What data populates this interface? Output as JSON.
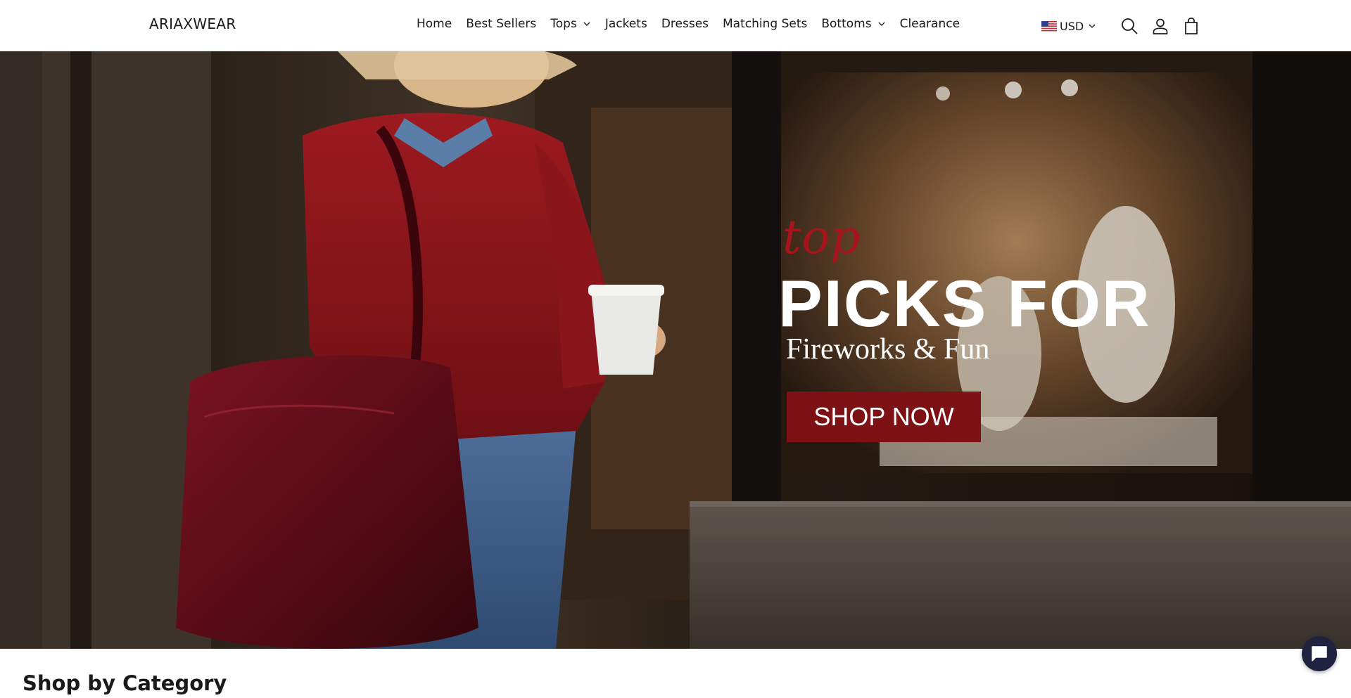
{
  "header": {
    "logo": "ARIAXWEAR",
    "nav": [
      {
        "label": "Home"
      },
      {
        "label": "Best Sellers"
      },
      {
        "label": "Tops",
        "has_dropdown": true
      },
      {
        "label": "Jackets"
      },
      {
        "label": "Dresses"
      },
      {
        "label": "Matching Sets"
      },
      {
        "label": "Bottoms",
        "has_dropdown": true
      },
      {
        "label": "Clearance"
      }
    ],
    "currency": {
      "label": "USD",
      "flag": "us-flag-icon"
    },
    "icons": [
      "search-icon",
      "account-icon",
      "cart-icon"
    ]
  },
  "hero": {
    "script_text": "top",
    "title": "PICKS FOR",
    "subtitle": "Fireworks & Fun",
    "cta_label": "SHOP NOW",
    "colors": {
      "accent": "#a8141c",
      "cta_bg": "#7e1114",
      "text": "#ffffff"
    }
  },
  "category_section": {
    "title": "Shop by Category"
  },
  "chat": {
    "icon": "chat-icon"
  }
}
